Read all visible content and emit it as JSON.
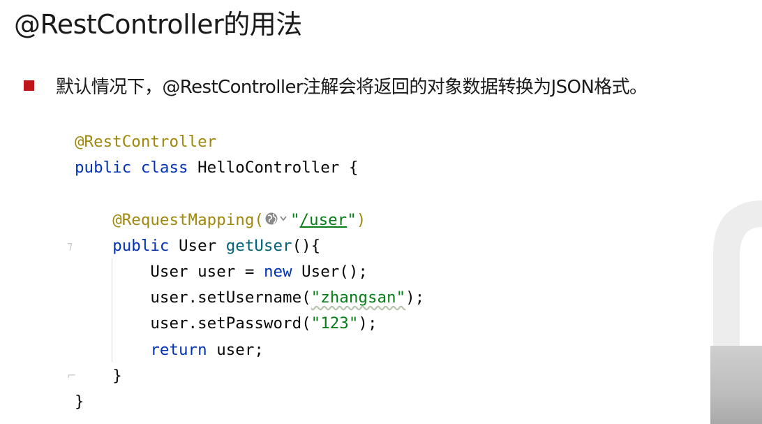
{
  "slide": {
    "title": "@RestController的用法",
    "bullet_text": "默认情况下，@RestController注解会将返回的对象数据转换为JSON格式。",
    "colors": {
      "bullet": "#c0161b",
      "annotation": "#9e880d",
      "keyword": "#0033b3",
      "string": "#067d17",
      "method": "#00627a"
    }
  },
  "code": {
    "line1_annotation": "@RestController",
    "line2_kw_public": "public",
    "line2_kw_class": "class",
    "line2_rest": " HelloController {",
    "line4_annotation": "@RequestMapping(",
    "line4_icon": "globe-icon",
    "line4_quote_open": "\"",
    "line4_path": "/user",
    "line4_quote_close": "\"",
    "line4_paren": ")",
    "line5_kw_public": "public",
    "line5_type": " User ",
    "line5_method": "getUser",
    "line5_rest": "(){",
    "line6_a": "User user = ",
    "line6_kw_new": "new",
    "line6_b": " User();",
    "line7_a": "user.setUsername(",
    "line7_str": "\"zhangsan\"",
    "line7_b": ");",
    "line8_a": "user.setPassword(",
    "line8_str": "\"123\"",
    "line8_b": ");",
    "line9_kw_return": "return",
    "line9_b": " user;",
    "line10": "}",
    "line11": "}"
  }
}
